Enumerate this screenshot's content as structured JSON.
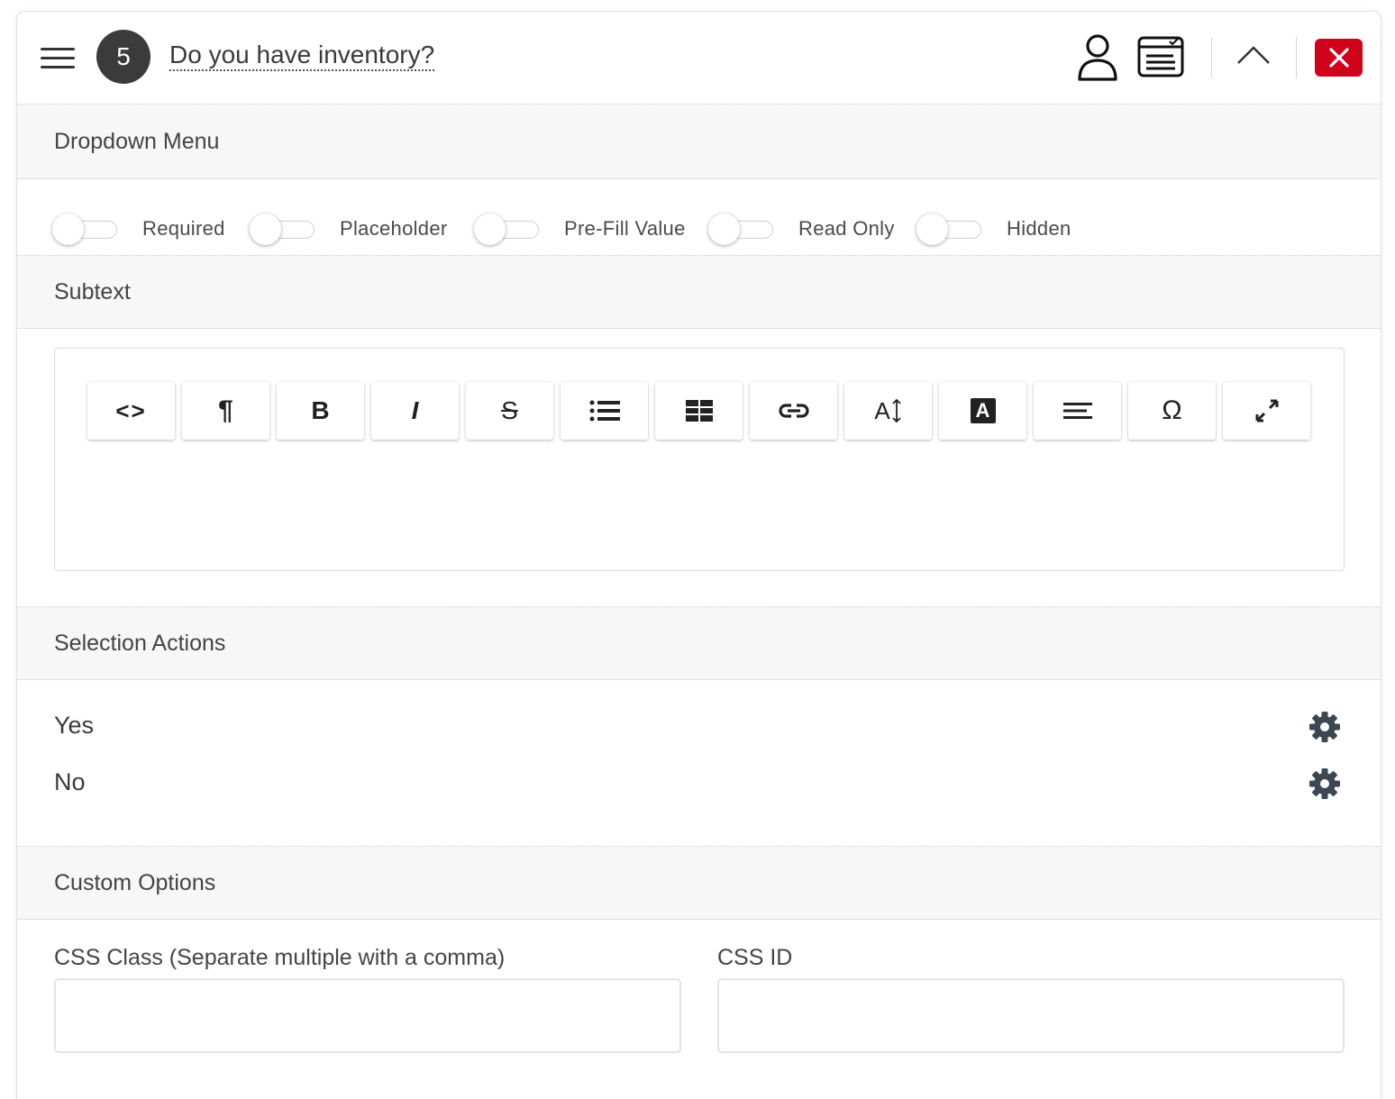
{
  "header": {
    "step_number": "5",
    "question_title": "Do you have inventory?"
  },
  "sections": {
    "field_type": "Dropdown Menu",
    "subtext": "Subtext",
    "selection_actions": "Selection Actions",
    "custom_options": "Custom Options"
  },
  "toggles": [
    {
      "label": "Required",
      "on": false
    },
    {
      "label": "Placeholder",
      "on": false
    },
    {
      "label": "Pre-Fill Value",
      "on": false
    },
    {
      "label": "Read Only",
      "on": false
    },
    {
      "label": "Hidden",
      "on": false
    }
  ],
  "toolbar": {
    "bold_glyph": "B",
    "italic_glyph": "I",
    "strike_glyph": "S",
    "paragraph_glyph": "¶",
    "code_glyph": "<>",
    "special_char_glyph": "Ω",
    "text_color_glyph": "A",
    "font_size_glyph": "A"
  },
  "selection_actions": [
    {
      "label": "Yes"
    },
    {
      "label": "No"
    }
  ],
  "custom_options": {
    "css_class_label": "CSS Class (Separate multiple with a comma)",
    "css_class_value": "",
    "css_id_label": "CSS ID",
    "css_id_value": ""
  },
  "colors": {
    "close_button": "#d0021b",
    "step_badge": "#3b3b3b",
    "gear_icon": "#3c4753",
    "section_bg": "#f7f7f7"
  }
}
